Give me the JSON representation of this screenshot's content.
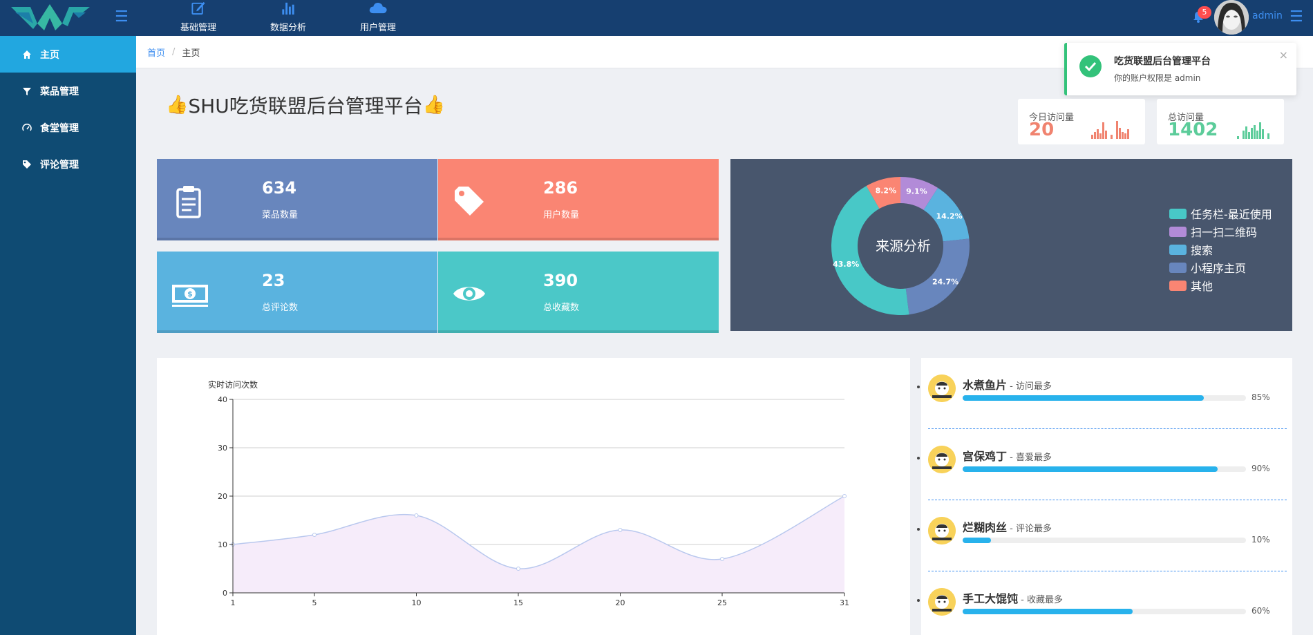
{
  "topnav": {
    "items": [
      {
        "label": "基础管理",
        "icon": "edit-icon"
      },
      {
        "label": "数据分析",
        "icon": "bar-chart-icon"
      },
      {
        "label": "用户管理",
        "icon": "cloud-icon"
      }
    ],
    "notification_count": "5",
    "admin_label": "admin"
  },
  "sidebar": {
    "items": [
      {
        "label": "主页",
        "icon": "home-icon",
        "active": true
      },
      {
        "label": "菜品管理",
        "icon": "filter-icon"
      },
      {
        "label": "食堂管理",
        "icon": "dashboard-icon"
      },
      {
        "label": "评论管理",
        "icon": "tag-icon"
      }
    ]
  },
  "breadcrumb": {
    "home": "首页",
    "separator": "/",
    "current": "主页"
  },
  "toast": {
    "title": "吃货联盟后台管理平台",
    "message": "你的账户权限是 admin",
    "close": "×"
  },
  "page": {
    "title": "SHU吃货联盟后台管理平台",
    "thumb": "👍"
  },
  "visits": [
    {
      "label": "今日访问量",
      "value": "20",
      "color": "#f0836f"
    },
    {
      "label": "总访问量",
      "value": "1402",
      "color": "#5ccc9a"
    }
  ],
  "tiles": [
    {
      "value": "634",
      "label": "菜品数量",
      "icon": "clipboard-icon",
      "color": "#6886bd"
    },
    {
      "value": "286",
      "label": "用户数量",
      "icon": "tags-icon",
      "color": "#fa8573"
    },
    {
      "value": "23",
      "label": "总评论数",
      "icon": "money-icon",
      "color": "#5ab3df"
    },
    {
      "value": "390",
      "label": "总收藏数",
      "icon": "eye-icon",
      "color": "#4bc8c8"
    }
  ],
  "donut": {
    "center_label": "来源分析",
    "slices": [
      {
        "name": "任务栏-最近使用",
        "value": 43.8,
        "label": "43.8%",
        "color": "#48c8c7"
      },
      {
        "name": "扫一扫二维码",
        "value": 9.1,
        "label": "9.1%",
        "color": "#b28bd8"
      },
      {
        "name": "搜索",
        "value": 14.2,
        "label": "14.2%",
        "color": "#5ab3df"
      },
      {
        "name": "小程序主页",
        "value": 24.7,
        "label": "24.7%",
        "color": "#6886bd"
      },
      {
        "name": "其他",
        "value": 8.2,
        "label": "8.2%",
        "color": "#fa8573"
      }
    ]
  },
  "chart_data": {
    "type": "area",
    "ylabel": "实时访问次数",
    "x": [
      1,
      5,
      10,
      15,
      20,
      25,
      31
    ],
    "values": [
      10,
      12,
      16,
      5,
      13,
      7,
      20
    ],
    "xticks": [
      "1",
      "5",
      "10",
      "15",
      "20",
      "25",
      "31"
    ],
    "yticks": [
      "0",
      "10",
      "20",
      "30",
      "40"
    ],
    "ylim": [
      0,
      40
    ],
    "xlim": [
      1,
      31
    ],
    "grid": true,
    "line_color": "#b9c8ee",
    "fill_color": "#f6ecfa"
  },
  "ranking": [
    {
      "name": "水煮鱼片",
      "tag": " - 访问最多",
      "percent": 85,
      "pct_label": "85%"
    },
    {
      "name": "宫保鸡丁",
      "tag": " - 喜爱最多",
      "percent": 90,
      "pct_label": "90%"
    },
    {
      "name": "烂糊肉丝",
      "tag": " - 评论最多",
      "percent": 10,
      "pct_label": "10%"
    },
    {
      "name": "手工大馄饨",
      "tag": " - 收藏最多",
      "percent": 60,
      "pct_label": "60%"
    }
  ]
}
